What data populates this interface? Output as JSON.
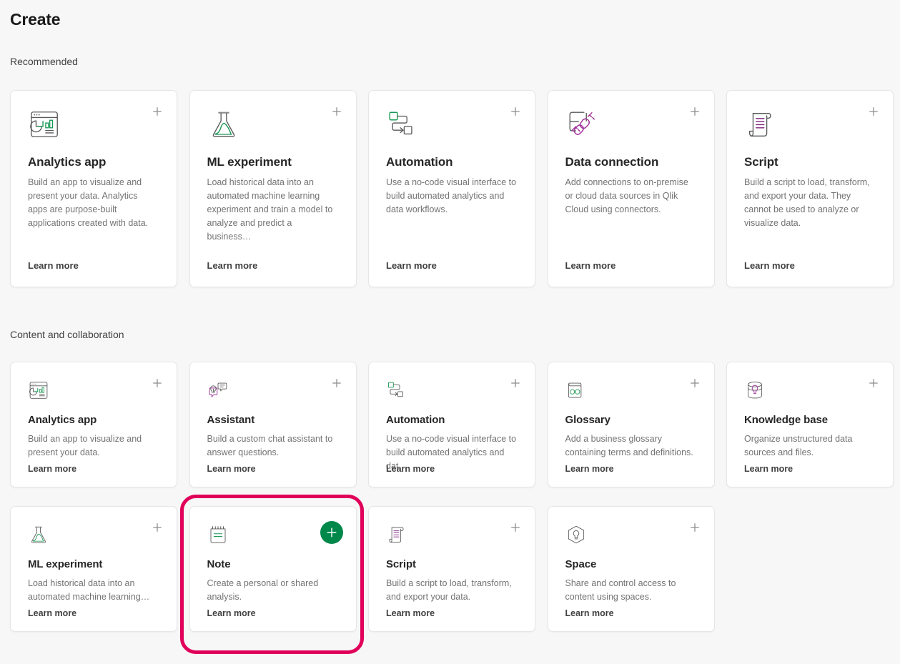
{
  "page": {
    "title": "Create"
  },
  "sections": [
    {
      "heading": "Recommended",
      "cards": [
        {
          "icon": "analytics-app-icon",
          "title": "Analytics app",
          "desc": "Build an app to visualize and present your data. Analytics apps are purpose-built applications created with data.",
          "learn_more": "Learn more",
          "add_label": "+"
        },
        {
          "icon": "ml-experiment-icon",
          "title": "ML experiment",
          "desc": "Load historical data into an automated machine learning experiment and train a model to analyze and predict a business…",
          "learn_more": "Learn more",
          "add_label": "+"
        },
        {
          "icon": "automation-icon",
          "title": "Automation",
          "desc": "Use a no-code visual interface to build automated analytics and data workflows.",
          "learn_more": "Learn more",
          "add_label": "+"
        },
        {
          "icon": "data-connection-icon",
          "title": "Data connection",
          "desc": "Add connections to on-premise or cloud data sources in Qlik Cloud using connectors.",
          "learn_more": "Learn more",
          "add_label": "+"
        },
        {
          "icon": "script-icon",
          "title": "Script",
          "desc": "Build a script to load, transform, and export your data. They cannot be used to analyze or visualize data.",
          "learn_more": "Learn more",
          "add_label": "+"
        }
      ]
    },
    {
      "heading": "Content and collaboration",
      "cards": [
        {
          "icon": "analytics-app-icon",
          "title": "Analytics app",
          "desc": "Build an app to visualize and present your data.",
          "learn_more": "Learn more",
          "add_label": "+"
        },
        {
          "icon": "assistant-icon",
          "title": "Assistant",
          "desc": "Build a custom chat assistant to answer questions.",
          "learn_more": "Learn more",
          "add_label": "+"
        },
        {
          "icon": "automation-icon",
          "title": "Automation",
          "desc": "Use a no-code visual interface to build automated analytics and dat…",
          "learn_more": "Learn more",
          "add_label": "+"
        },
        {
          "icon": "glossary-icon",
          "title": "Glossary",
          "desc": "Add a business glossary containing terms and definitions.",
          "learn_more": "Learn more",
          "add_label": "+"
        },
        {
          "icon": "knowledge-base-icon",
          "title": "Knowledge base",
          "desc": "Organize unstructured data sources and files.",
          "learn_more": "Learn more",
          "add_label": "+"
        },
        {
          "icon": "ml-experiment-icon",
          "title": "ML experiment",
          "desc": "Load historical data into an automated machine learning…",
          "learn_more": "Learn more",
          "add_label": "+"
        },
        {
          "icon": "note-icon",
          "title": "Note",
          "desc": "Create a personal or shared analysis.",
          "learn_more": "Learn more",
          "add_label": "+",
          "highlighted": true,
          "add_active": true
        },
        {
          "icon": "script-icon",
          "title": "Script",
          "desc": "Build a script to load, transform, and export your data.",
          "learn_more": "Learn more",
          "add_label": "+"
        },
        {
          "icon": "space-icon",
          "title": "Space",
          "desc": "Share and control access to content using spaces.",
          "learn_more": "Learn more",
          "add_label": "+"
        }
      ]
    }
  ],
  "colors": {
    "background": "#f7f7f7",
    "card_background": "#ffffff",
    "accent_green": "#00874a",
    "accent_magenta": "#a0329b",
    "highlight_ring": "#e0005a",
    "icon_stroke": "#595959",
    "text_primary": "#262626",
    "text_secondary": "#737373"
  }
}
